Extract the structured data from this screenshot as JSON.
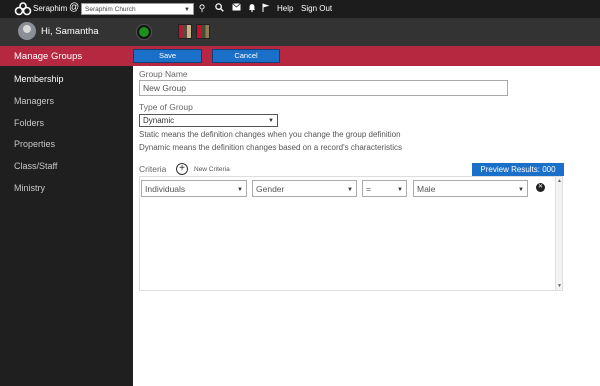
{
  "topbar": {
    "brand": "Seraphim",
    "at": "@",
    "church": "Seraphim Church",
    "links": {
      "help": "Help",
      "signout": "Sign Out"
    }
  },
  "userbar": {
    "greeting": "Hi, Samantha"
  },
  "sidebar": {
    "heading": "Manage Groups",
    "items": [
      {
        "label": "Membership"
      },
      {
        "label": "Managers"
      },
      {
        "label": "Folders"
      },
      {
        "label": "Properties"
      },
      {
        "label": "Class/Staff"
      },
      {
        "label": "Ministry"
      }
    ]
  },
  "actions": {
    "save": "Save",
    "cancel": "Cancel"
  },
  "form": {
    "name_label": "Group Name",
    "name_value": "New Group",
    "type_label": "Type of Group",
    "type_value": "Dynamic",
    "desc_static": "Static means the definition changes when you change the group definition",
    "desc_dynamic": "Dynamic means the definition changes based on a record's characteristics",
    "criteria_label": "Criteria",
    "new_criteria": "New Criteria",
    "preview": "Preview Results: 000",
    "row": {
      "entity": "Individuals",
      "field": "Gender",
      "operator": "=",
      "value": "Male"
    }
  },
  "colors": {
    "accent": "#b5283f",
    "button": "#1a6fc9",
    "sidebar": "#1f1f1f",
    "status": "#1d8f1d"
  }
}
